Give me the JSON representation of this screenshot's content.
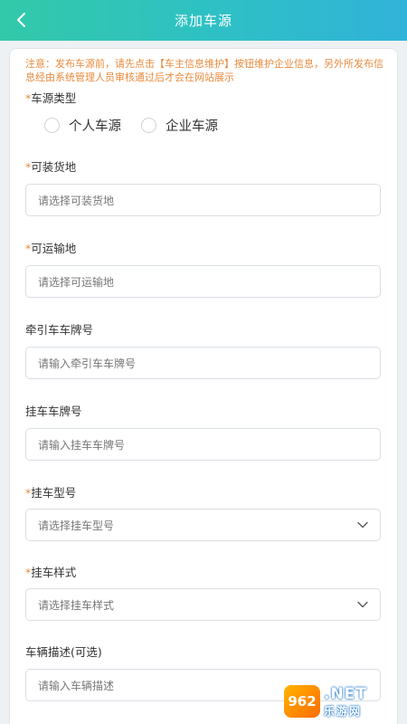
{
  "header": {
    "title": "添加车源",
    "back_icon": "chevron-left-icon"
  },
  "notice": "注意：发布车源前，请先点击【车主信息维护】按钮维护企业信息，另外所发布信息经由系统管理人员审核通过后才会在网站展示",
  "vehicle_source_type": {
    "required_mark": "*",
    "label": "车源类型",
    "options": [
      "个人车源",
      "企业车源"
    ]
  },
  "loading_place": {
    "required_mark": "*",
    "label": "可装货地",
    "placeholder": "请选择可装货地"
  },
  "transport_place": {
    "required_mark": "*",
    "label": "可运输地",
    "placeholder": "请选择可运输地"
  },
  "tractor_plate": {
    "label": "牵引车车牌号",
    "placeholder": "请输入牵引车车牌号"
  },
  "trailer_plate": {
    "label": "挂车车牌号",
    "placeholder": "请输入挂车车牌号"
  },
  "trailer_model": {
    "required_mark": "*",
    "label": "挂车型号",
    "placeholder": "请选择挂车型号"
  },
  "trailer_style": {
    "required_mark": "*",
    "label": "挂车样式",
    "placeholder": "请选择挂车样式"
  },
  "vehicle_description": {
    "label": "车辆描述(可选)",
    "placeholder": "请输入车辆描述"
  },
  "watermark": {
    "badge": "962",
    "net": ".NET",
    "site": "乐游网"
  },
  "colors": {
    "header_gradient_start": "#32c9a9",
    "header_gradient_end": "#31b3d9",
    "notice": "#e88a3c",
    "required": "#e88a3c"
  }
}
